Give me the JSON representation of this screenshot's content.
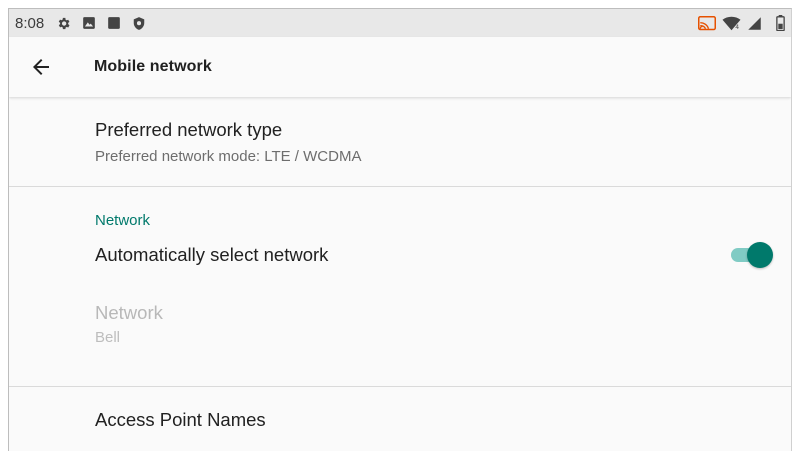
{
  "status_bar": {
    "time": "8:08",
    "left_icons": [
      "gear-icon",
      "photo-icon",
      "square-icon",
      "shield-icon"
    ],
    "right_icons": [
      "cast-icon",
      "wifi-icon",
      "cell-signal-icon",
      "battery-icon"
    ]
  },
  "app_bar": {
    "back_icon": "arrow-left-icon",
    "title": "Mobile network"
  },
  "preferences": {
    "preferred_network_type": {
      "title": "Preferred network type",
      "summary": "Preferred network mode: LTE / WCDMA"
    },
    "network_section": {
      "header": "Network"
    },
    "auto_select": {
      "title": "Automatically select network",
      "enabled": true
    },
    "network": {
      "title": "Network",
      "summary": "Bell"
    },
    "apn": {
      "title": "Access Point Names"
    }
  },
  "colors": {
    "accent": "#00796b",
    "accent_light": "#80cbc4",
    "status_bar_bg": "#e8e8e8",
    "background": "#fafafa"
  }
}
